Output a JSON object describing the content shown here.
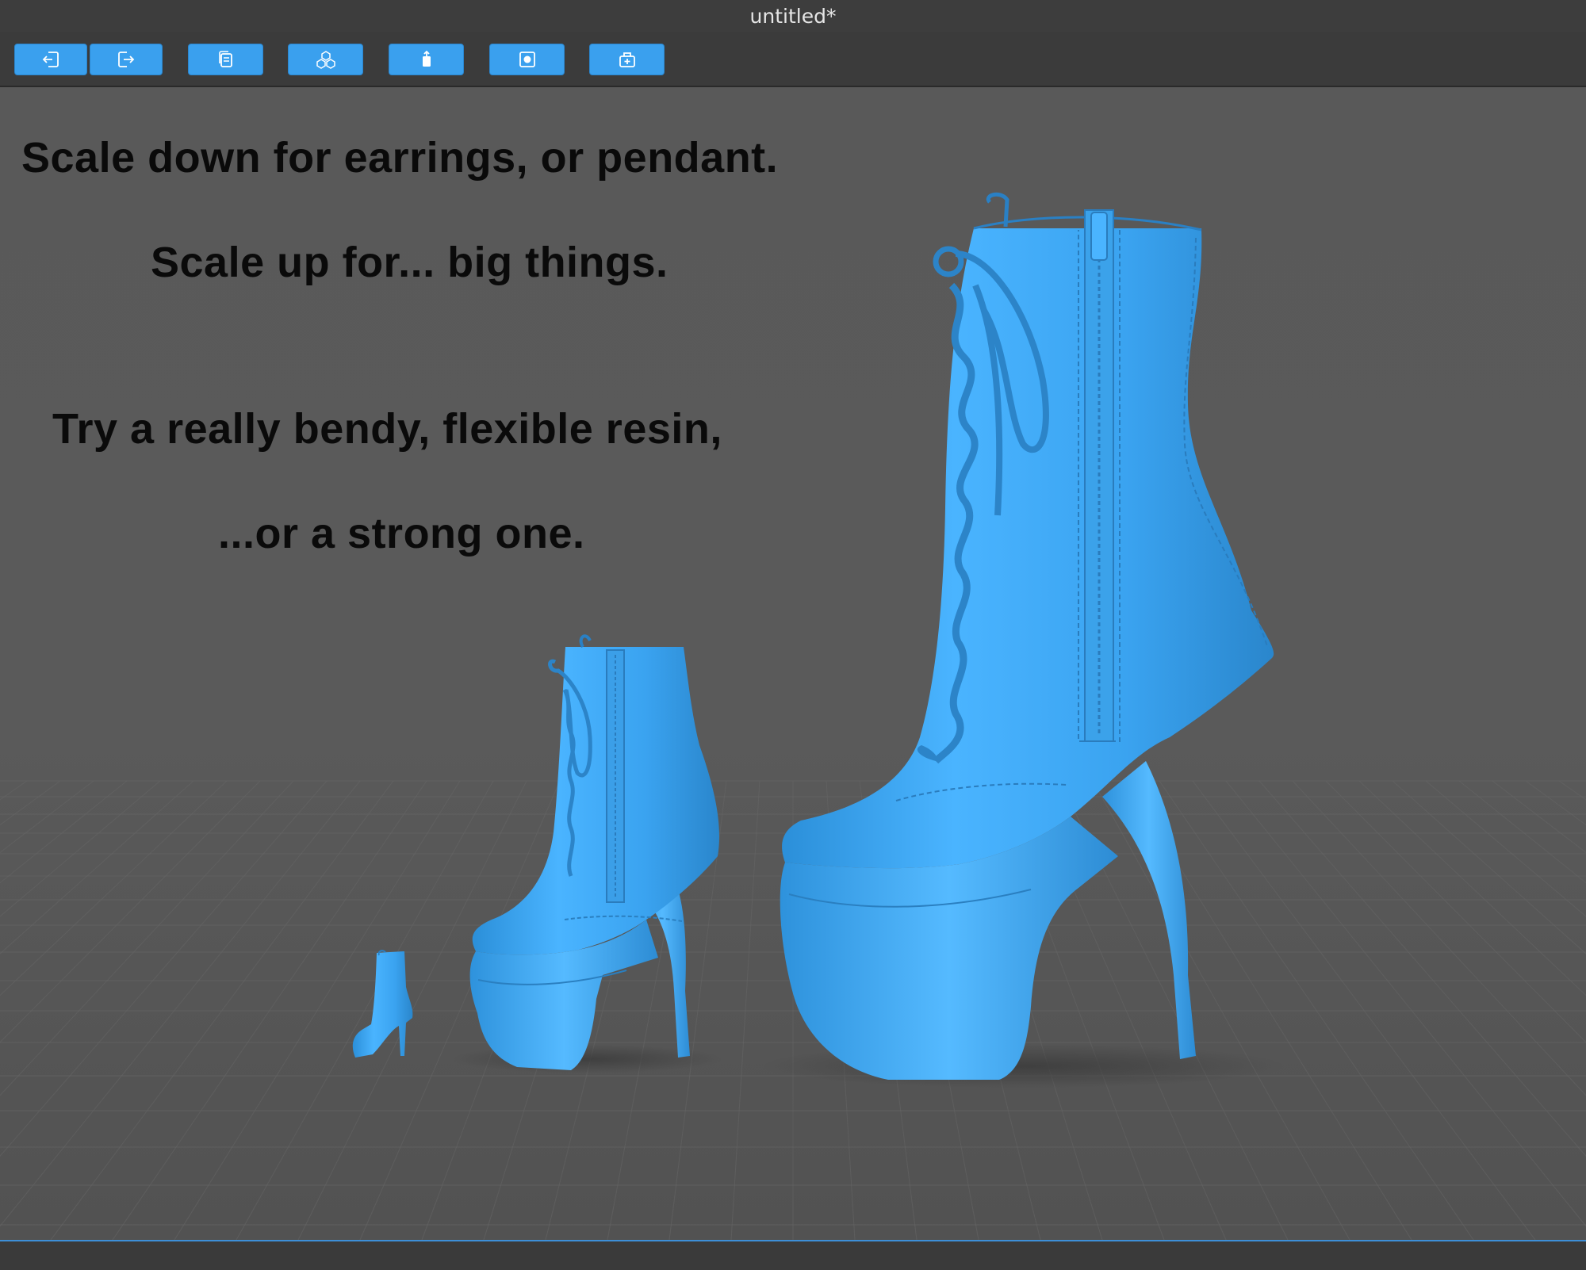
{
  "window": {
    "title": "untitled*"
  },
  "toolbar": {
    "buttons": [
      {
        "icon": "import-icon"
      },
      {
        "icon": "export-icon"
      },
      {
        "icon": "copy-icon"
      },
      {
        "icon": "objects-icon"
      },
      {
        "icon": "supports-icon"
      },
      {
        "icon": "slice-icon"
      },
      {
        "icon": "print-icon"
      }
    ]
  },
  "viewport": {
    "captions": [
      "Scale down for earrings, or pendant.",
      "Scale up for... big things.",
      "Try a really bendy, flexible resin,",
      "...or a strong one."
    ],
    "model_color": "#3fa6f2",
    "models": [
      "boot-model-small",
      "boot-model-medium",
      "boot-model-large"
    ]
  },
  "colors": {
    "accent": "#3aa0ee",
    "title_text": "#e6e6e6",
    "caption_text": "#0a0a0a",
    "viewport_bg": "#595959"
  }
}
